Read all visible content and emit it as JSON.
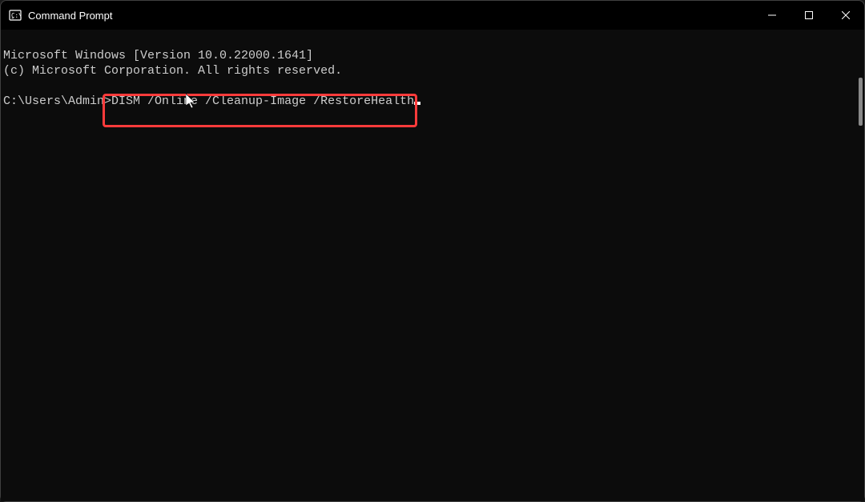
{
  "titlebar": {
    "title": "Command Prompt",
    "icon_name": "cmd-icon"
  },
  "window_controls": {
    "minimize": "minimize",
    "maximize": "maximize",
    "close": "close"
  },
  "terminal": {
    "line1": "Microsoft Windows [Version 10.0.22000.1641]",
    "line2": "(c) Microsoft Corporation. All rights reserved.",
    "prompt": "C:\\Users\\Admin>",
    "command": "DISM /Online /Cleanup-Image /RestoreHealth"
  }
}
